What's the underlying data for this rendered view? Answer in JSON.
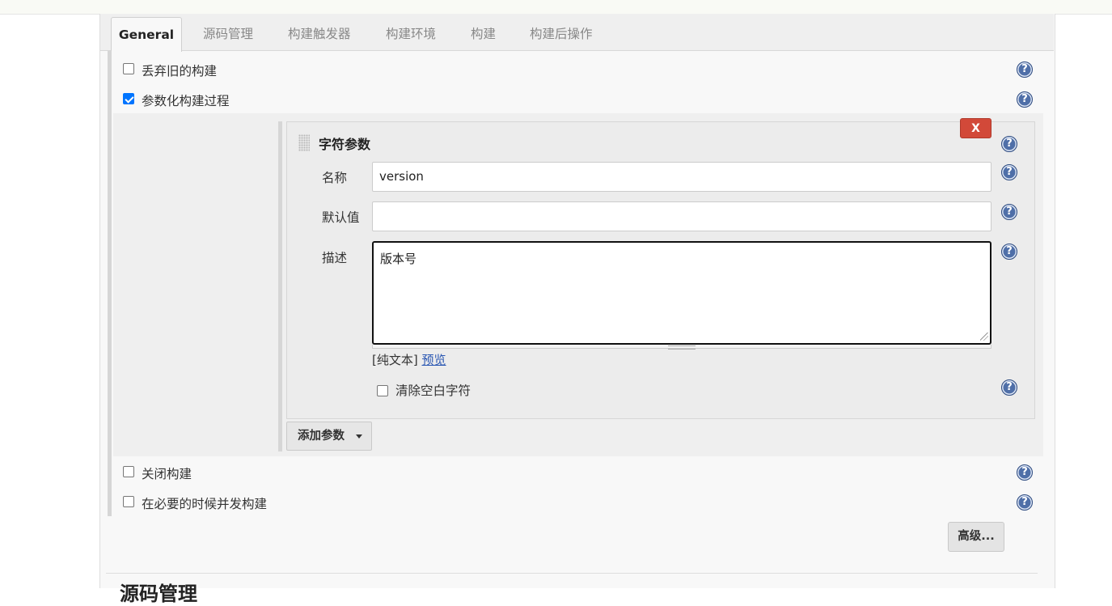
{
  "tabs": [
    "General",
    "源码管理",
    "构建触发器",
    "构建环境",
    "构建",
    "构建后操作"
  ],
  "options": {
    "discard_old": {
      "label": "丢弃旧的构建",
      "checked": false
    },
    "parameterized": {
      "label": "参数化构建过程",
      "checked": true
    },
    "disable_build": {
      "label": "关闭构建",
      "checked": false
    },
    "concurrent": {
      "label": "在必要的时候并发构建",
      "checked": false
    }
  },
  "param": {
    "title": "字符参数",
    "delete_label": "X",
    "name_label": "名称",
    "name_value": "version",
    "default_label": "默认值",
    "default_value": "",
    "desc_label": "描述",
    "desc_value": "版本号",
    "plain_text": "[纯文本]",
    "preview": "预览",
    "trim_label": "清除空白字符",
    "trim_checked": false
  },
  "add_param_label": "添加参数",
  "advanced_label": "高级...",
  "next_section": "源码管理",
  "help_glyph": "?",
  "colors": {
    "accent": "#0075ff",
    "delete": "#d24939",
    "help": "#4f6fa8",
    "link": "#2956b2"
  }
}
